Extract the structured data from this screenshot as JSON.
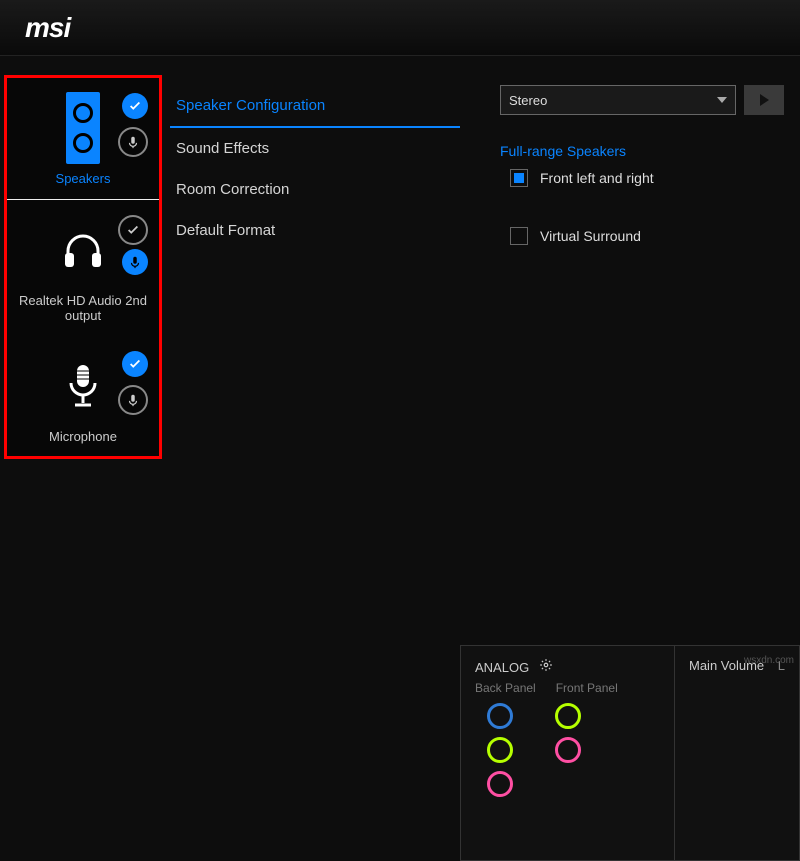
{
  "brand": "msi",
  "devices": [
    {
      "label": "Speakers",
      "active": true,
      "check": true,
      "mic": false
    },
    {
      "label": "Realtek HD Audio 2nd output",
      "active": false,
      "check": false,
      "mic": true
    },
    {
      "label": "Microphone",
      "active": false,
      "check": true,
      "mic": false
    }
  ],
  "nav": {
    "items": [
      "Speaker Configuration",
      "Sound Effects",
      "Room Correction",
      "Default Format"
    ],
    "active_index": 0
  },
  "config": {
    "mode_selected": "Stereo",
    "fullrange_title": "Full-range Speakers",
    "front_lr_label": "Front left and right",
    "front_lr_checked": true,
    "virtual_surround_label": "Virtual Surround",
    "virtual_surround_checked": false
  },
  "analog": {
    "title": "ANALOG",
    "back_label": "Back Panel",
    "front_label": "Front Panel",
    "jacks_back": [
      "#2f7bd6",
      "#b6ff00",
      "#ff4fa3"
    ],
    "jacks_front": [
      "#b6ff00",
      "#ff4fa3"
    ]
  },
  "volume": {
    "title": "Main Volume",
    "channel": "L"
  },
  "watermark": "wsxdn.com"
}
